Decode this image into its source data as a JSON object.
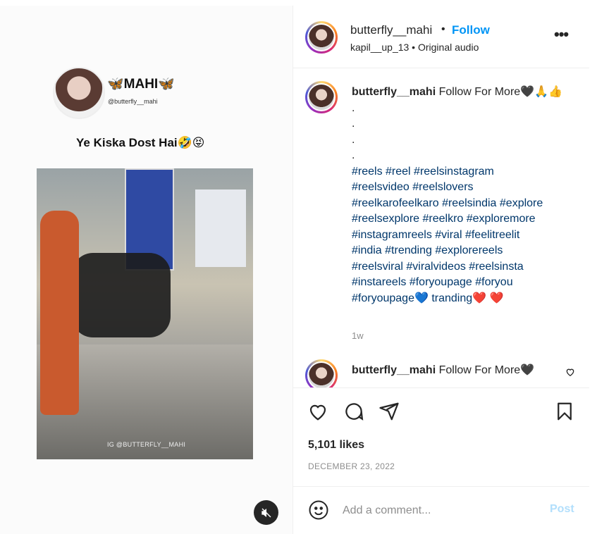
{
  "reel": {
    "name": "🦋MAHI🦋",
    "handle": "@butterfly__mahi",
    "caption": "Ye Kiska Dost Hai🤣😝",
    "watermark": "IG @BUTTERFLY__MAHI",
    "mute_icon": "speaker-muted-icon"
  },
  "header": {
    "username": "butterfly__mahi",
    "dot": "•",
    "follow_label": "Follow",
    "subtitle": "kapil__up_13 • Original audio",
    "more_label": "•••"
  },
  "caption": {
    "username": "butterfly__mahi",
    "text": "Follow For More🖤🙏👍",
    "dots": [
      ".",
      ".",
      ".",
      "."
    ],
    "hashtag_lines": [
      "#reels #reel #reelsinstagram",
      "#reelsvideo #reelslovers",
      "#reelkarofeelkaro #reelsindia #explore",
      "#reelsexplore #reelkro #exploremore",
      "#instagramreels #viral #feelitreelit",
      "#india #trending #explorereels",
      "#reelsviral #viralvideos #reelsinsta",
      "#instareels #foryoupage #foryou",
      "#foryoupage💙 tranding❤️ ❤️"
    ],
    "time": "1w"
  },
  "comment2": {
    "username": "butterfly__mahi",
    "text": "Follow For More🖤",
    "like_icon": "heart-outline-icon"
  },
  "actions": {
    "like_icon": "heart-icon",
    "comment_icon": "comment-icon",
    "share_icon": "share-icon",
    "save_icon": "bookmark-icon",
    "likes": "5,101 likes",
    "date": "DECEMBER 23, 2022"
  },
  "add_comment": {
    "emoji_icon": "emoji-icon",
    "placeholder": "Add a comment...",
    "post_label": "Post"
  },
  "colors": {
    "accent": "#0095f6",
    "hashtag": "#00376b",
    "muted": "#8e8e8e",
    "post_disabled": "#b2dffc"
  }
}
